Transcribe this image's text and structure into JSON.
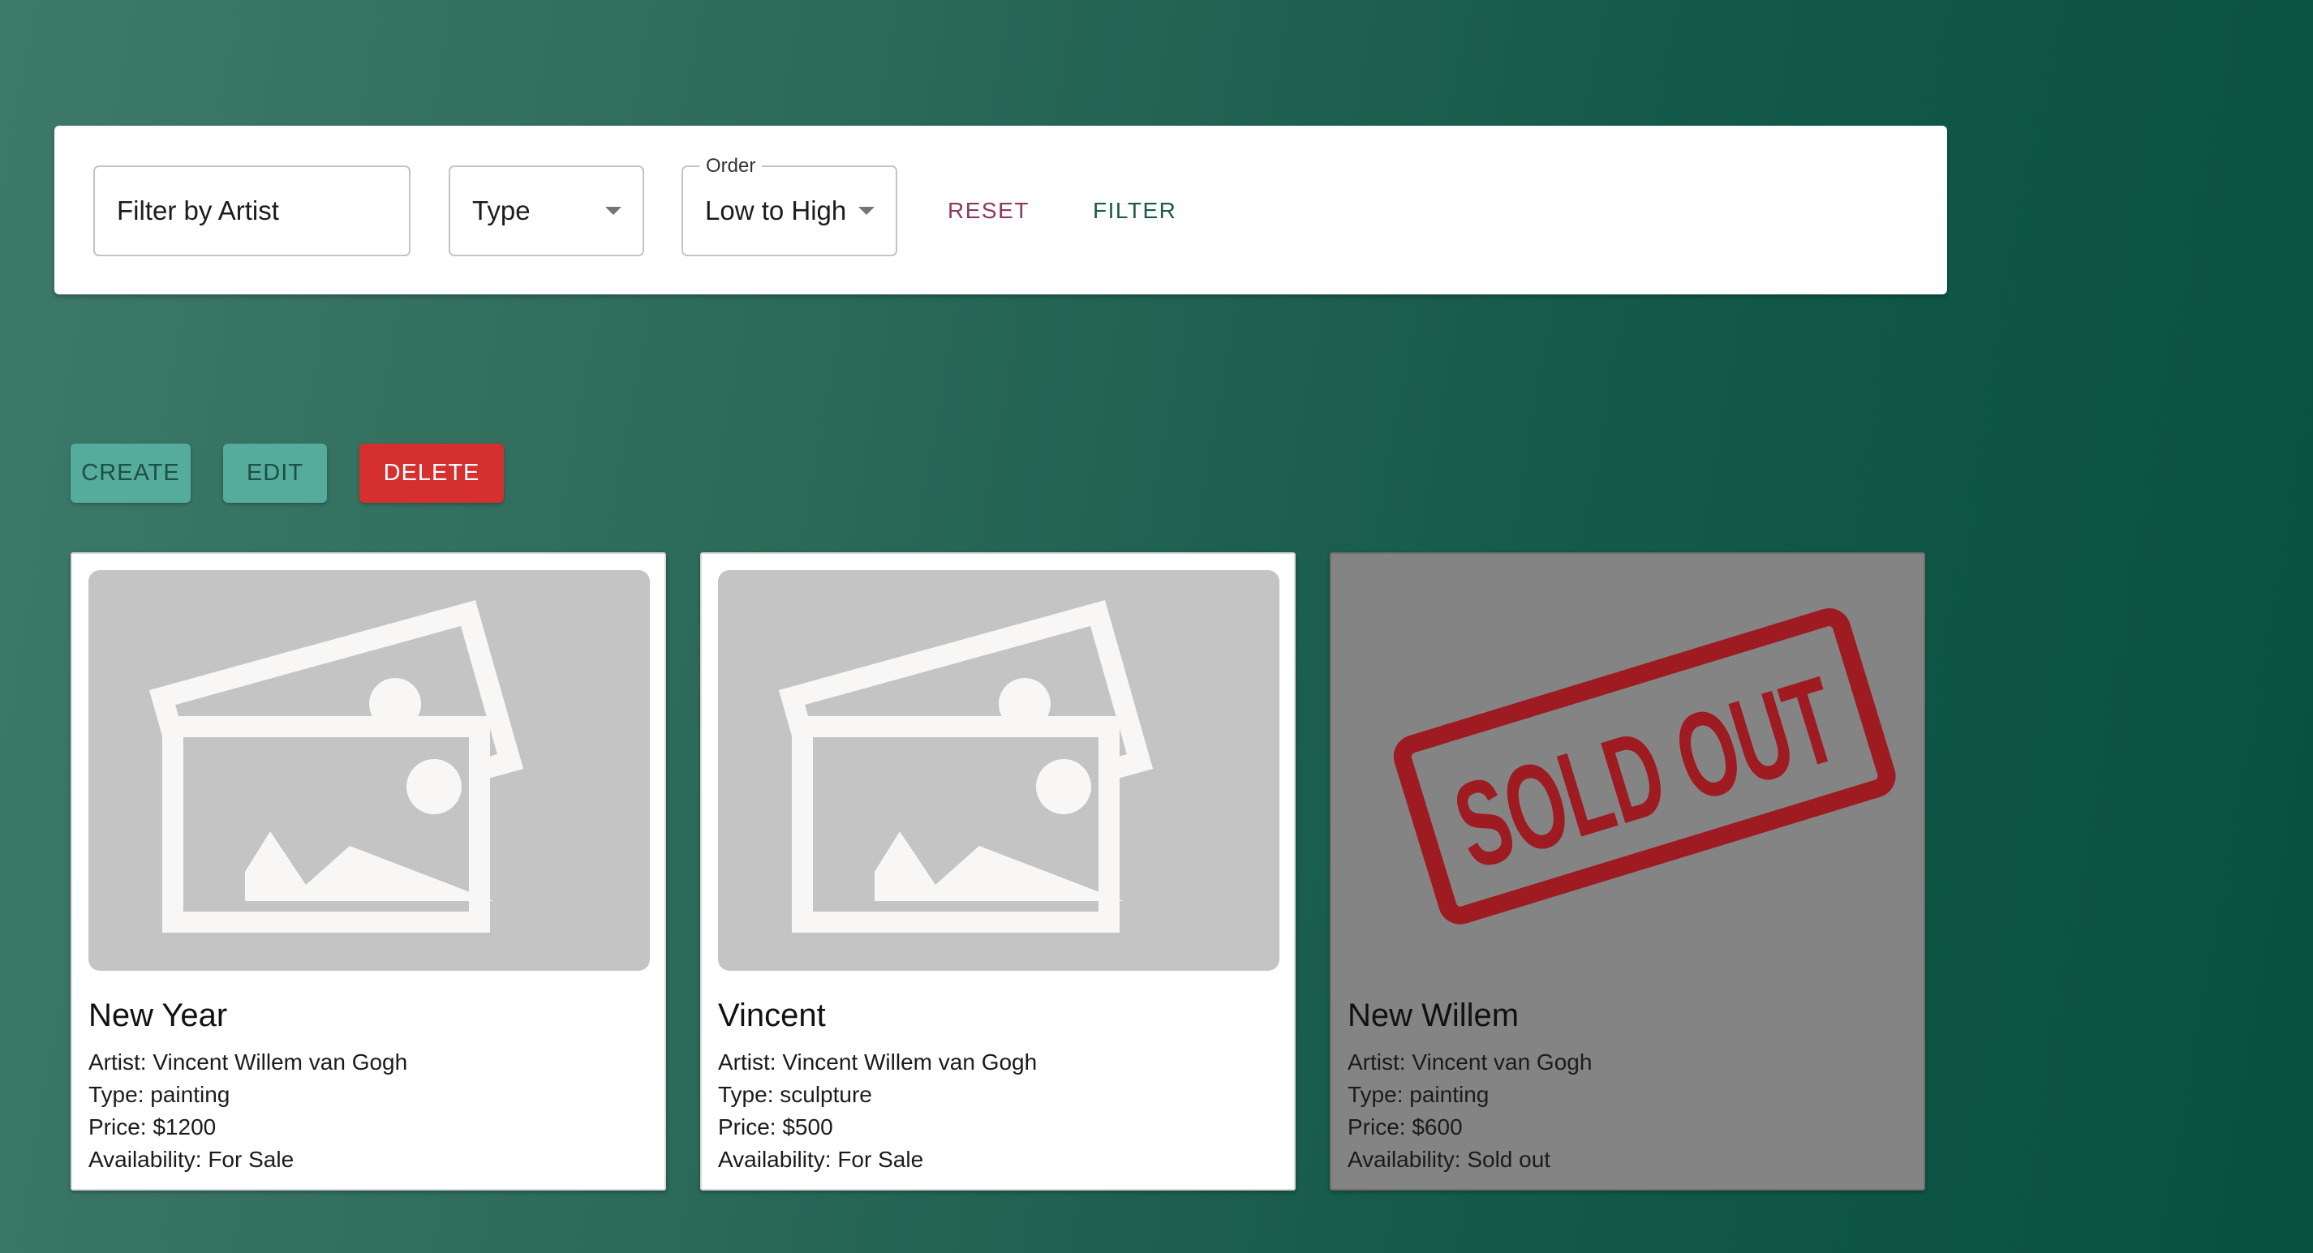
{
  "filters": {
    "artist_placeholder": "Filter by Artist",
    "type_label": "Type",
    "order_legend": "Order",
    "order_value": "Low to High",
    "reset_label": "RESET",
    "filter_label": "FILTER"
  },
  "actions": {
    "create_label": "CREATE",
    "edit_label": "EDIT",
    "delete_label": "DELETE"
  },
  "cards": [
    {
      "title": "New Year",
      "artist": "Artist: Vincent Willem van Gogh",
      "type": "Type: painting",
      "price": "Price: $1200",
      "availability": "Availability: For Sale",
      "image": "image-placeholder-icon"
    },
    {
      "title": "Vincent",
      "artist": "Artist: Vincent Willem van Gogh",
      "type": "Type: sculpture",
      "price": "Price: $500",
      "availability": "Availability: For Sale",
      "image": "image-placeholder-icon"
    },
    {
      "title": "New Willem",
      "artist": "Artist: Vincent van Gogh",
      "type": "Type: painting",
      "price": "Price: $600",
      "availability": "Availability: Sold out",
      "stamp": "SOLD OUT"
    }
  ],
  "colors": {
    "background_start": "#3e7a6a",
    "background_end": "#07503f",
    "create_edit_button": "#55ab9c",
    "delete_button": "#d62f2f",
    "reset_text": "#8b3a5c",
    "filter_text": "#1b5a45",
    "sold_out_stamp": "#9e1b22",
    "sold_out_card": "#848484"
  }
}
